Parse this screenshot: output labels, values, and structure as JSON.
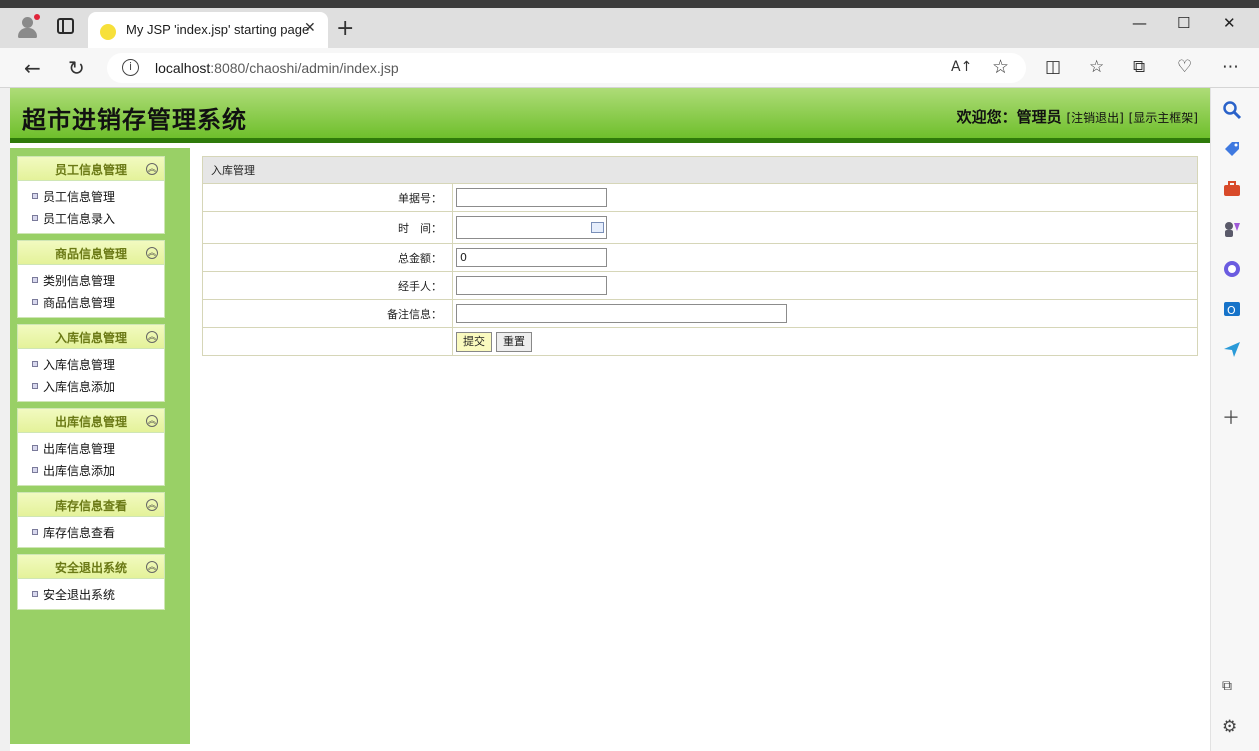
{
  "browser": {
    "tab_title": "My JSP 'index.jsp' starting page",
    "tab_close": "✕",
    "new_tab": "+",
    "url_host": "localhost",
    "url_rest": ":8080/chaoshi/admin/index.jsp",
    "read_aloud": "A↑",
    "info_glyph": "i",
    "minimize": "—",
    "maximize": "☐",
    "close": "✕"
  },
  "header": {
    "system_title": "超市进销存管理系统",
    "welcome_label": "欢迎您：",
    "user_name": "管理员",
    "logout": "[注销退出]",
    "show_main": "[显示主框架]"
  },
  "menus": [
    {
      "title": "员工信息管理",
      "items": [
        "员工信息管理",
        "员工信息录入"
      ]
    },
    {
      "title": "商品信息管理",
      "items": [
        "类别信息管理",
        "商品信息管理"
      ]
    },
    {
      "title": "入库信息管理",
      "items": [
        "入库信息管理",
        "入库信息添加"
      ]
    },
    {
      "title": "出库信息管理",
      "items": [
        "出库信息管理",
        "出库信息添加"
      ]
    },
    {
      "title": "库存信息查看",
      "items": [
        "库存信息查看"
      ]
    },
    {
      "title": "安全退出系统",
      "items": [
        "安全退出系统"
      ]
    }
  ],
  "form": {
    "caption": "入库管理",
    "fields": {
      "bill_no": {
        "label": "单据号：",
        "value": ""
      },
      "time": {
        "label": "时　间：",
        "value": ""
      },
      "total": {
        "label": "总金额：",
        "value": "0"
      },
      "handler": {
        "label": "经手人：",
        "value": ""
      },
      "remark": {
        "label": "备注信息：",
        "value": ""
      }
    },
    "submit": "提交",
    "reset": "重置"
  }
}
